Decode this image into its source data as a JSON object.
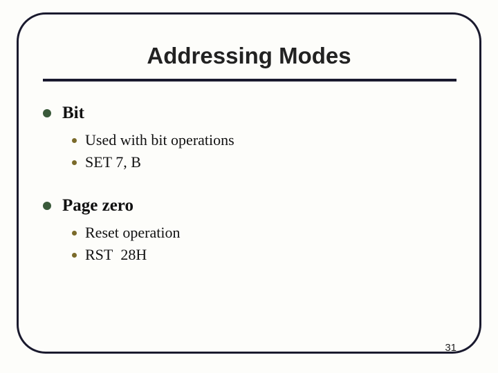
{
  "title": "Addressing Modes",
  "sections": [
    {
      "heading": "Bit",
      "items": [
        "Used with bit operations",
        "SET 7, B"
      ]
    },
    {
      "heading": "Page zero",
      "items": [
        "Reset operation",
        "RST  28H"
      ]
    }
  ],
  "page_number": "31"
}
